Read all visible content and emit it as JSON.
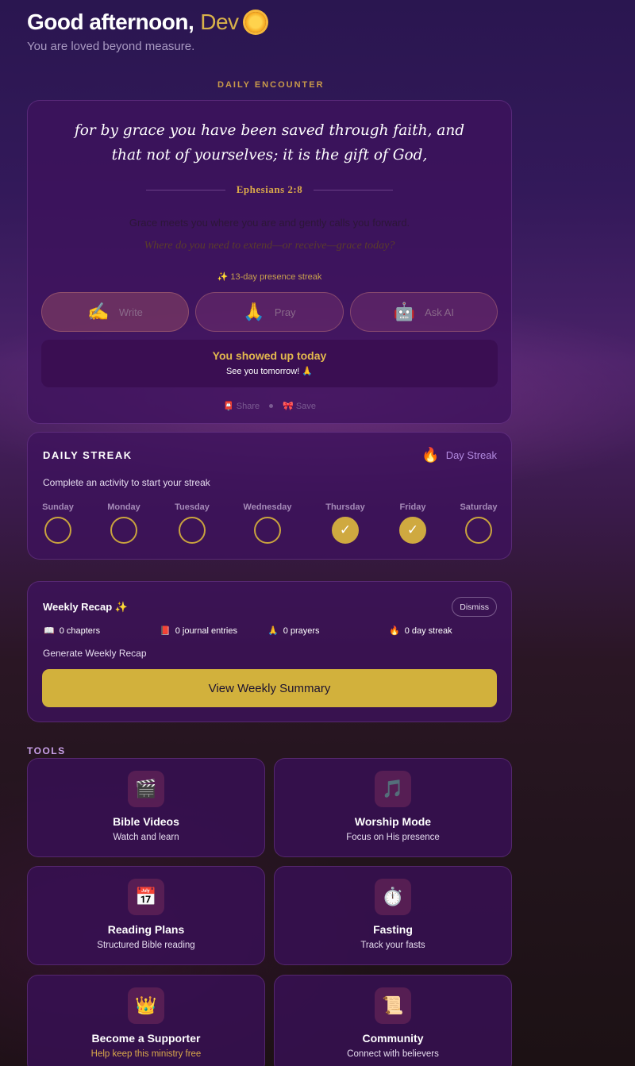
{
  "header": {
    "greeting": "Good afternoon,",
    "name": "Dev",
    "icon": "sun-icon",
    "subtitle": "You are loved beyond measure."
  },
  "encounter": {
    "section_label": "DAILY ENCOUNTER",
    "verse": "for by grace you have been saved through faith, and that not of yourselves; it is the gift of God,",
    "reference": "Ephesians 2:8",
    "reflection": "Grace meets you where you are and gently calls you forward.",
    "question": "Where do you need to extend—or receive—grace today?",
    "streak_pill": "✨ 13-day presence streak",
    "actions": [
      {
        "label": "Write",
        "icon": "writing-hand-icon",
        "glyph": "✍️"
      },
      {
        "label": "Pray",
        "icon": "praying-hands-icon",
        "glyph": "🙏"
      },
      {
        "label": "Ask AI",
        "icon": "robot-icon",
        "glyph": "🤖"
      }
    ],
    "showed_title": "You showed up today",
    "showed_sub": "See you tomorrow! 🙏",
    "share_label": "Share",
    "save_label": "Save"
  },
  "streak": {
    "title": "DAILY STREAK",
    "badge": "Day Streak",
    "message": "Complete an activity to start your streak",
    "days": [
      {
        "name": "Sunday",
        "done": false
      },
      {
        "name": "Monday",
        "done": false
      },
      {
        "name": "Tuesday",
        "done": false
      },
      {
        "name": "Wednesday",
        "done": false
      },
      {
        "name": "Thursday",
        "done": true
      },
      {
        "name": "Friday",
        "done": true
      },
      {
        "name": "Saturday",
        "done": false
      }
    ]
  },
  "recap": {
    "title": "Weekly Recap ✨",
    "dismiss_label": "Dismiss",
    "stats": [
      {
        "icon": "book-icon",
        "glyph": "📖",
        "text": "0 chapters"
      },
      {
        "icon": "journal-icon",
        "glyph": "📕",
        "text": "0 journal entries"
      },
      {
        "icon": "praying-hands-icon",
        "glyph": "🙏",
        "text": "0 prayers"
      },
      {
        "icon": "flame-icon",
        "glyph": "🔥",
        "text": "0 day streak"
      }
    ],
    "generate_label": "Generate Weekly Recap",
    "summary_button": "View Weekly Summary"
  },
  "tools": {
    "section_label": "TOOLS",
    "items": [
      {
        "title": "Bible Videos",
        "desc": "Watch and learn",
        "icon": "clapper-board-icon",
        "glyph": "🎬"
      },
      {
        "title": "Worship Mode",
        "desc": "Focus on His presence",
        "icon": "music-notes-icon",
        "glyph": "🎵"
      },
      {
        "title": "Reading Plans",
        "desc": "Structured Bible reading",
        "icon": "calendar-icon",
        "glyph": "📅"
      },
      {
        "title": "Fasting",
        "desc": "Track your fasts",
        "icon": "stopwatch-icon",
        "glyph": "⏱️"
      },
      {
        "title": "Become a Supporter",
        "desc": "Help keep this ministry free",
        "icon": "crown-icon",
        "glyph": "👑"
      },
      {
        "title": "Community",
        "desc": "Connect with believers",
        "icon": "scroll-icon",
        "glyph": "📜"
      }
    ]
  },
  "colors": {
    "accent_gold": "#d2b13c",
    "card_purple": "#3e125c",
    "streak_purple": "#b28ae0"
  }
}
